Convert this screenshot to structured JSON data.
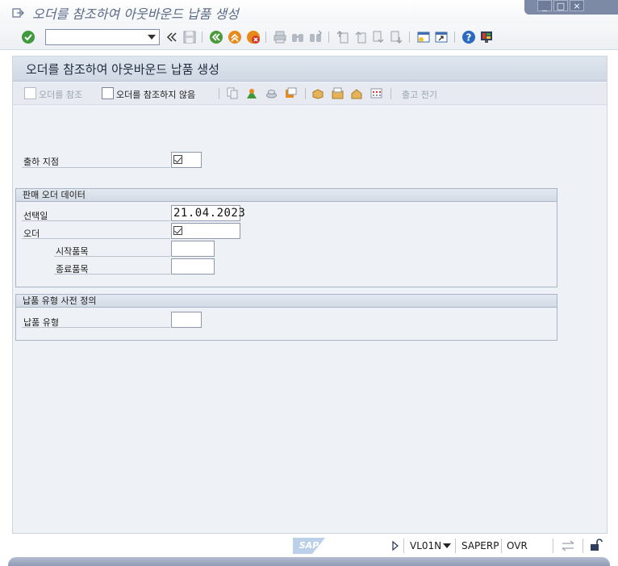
{
  "window": {
    "title": "오더를 참조하여 아웃바운드 납품 생성",
    "controls": {
      "minimize": "_",
      "maximize": "□",
      "close": "×"
    }
  },
  "toolbar": {
    "command_field": {
      "value": "",
      "placeholder": ""
    },
    "icons": [
      "enter-icon",
      "history-icon",
      "save-icon",
      "back-icon",
      "exit-icon",
      "cancel-icon",
      "print-icon",
      "find-icon",
      "find-next-icon",
      "first-page-icon",
      "previous-page-icon",
      "next-page-icon",
      "last-page-icon",
      "new-session-icon",
      "shortcut-icon",
      "help-icon",
      "customize-layout-icon"
    ]
  },
  "screen": {
    "title": "오더를 참조하여 아웃바운드 납품 생성",
    "app_toolbar": {
      "with_order": "오더를 참조",
      "without_order": "오더를 참조하지 않음",
      "post_goods_issue": "출고 전기"
    }
  },
  "form": {
    "shipping_point": {
      "label": "출하 지점",
      "value": ""
    },
    "sales_order_group": {
      "title": "판매 오더 데이터",
      "selection_date": {
        "label": "선택일",
        "value": "21.04.2023"
      },
      "order": {
        "label": "오더",
        "value": ""
      },
      "from_item": {
        "label": "시작품목",
        "value": ""
      },
      "to_item": {
        "label": "종료품목",
        "value": ""
      }
    },
    "delivery_type_group": {
      "title": "납품 유형 사전 정의",
      "delivery_type": {
        "label": "납품 유형",
        "value": ""
      }
    }
  },
  "statusbar": {
    "logo": "SAP",
    "transaction": "VL01N",
    "system": "SAPERP",
    "mode": "OVR"
  },
  "colors": {
    "panel_bg": "#eef1f6",
    "header_bg": "#d5dde8",
    "enter_green": "#3f9a3c",
    "nav_orange": "#e88a1a",
    "cancel_red": "#d23b2b",
    "help_blue": "#2a6bbf"
  }
}
